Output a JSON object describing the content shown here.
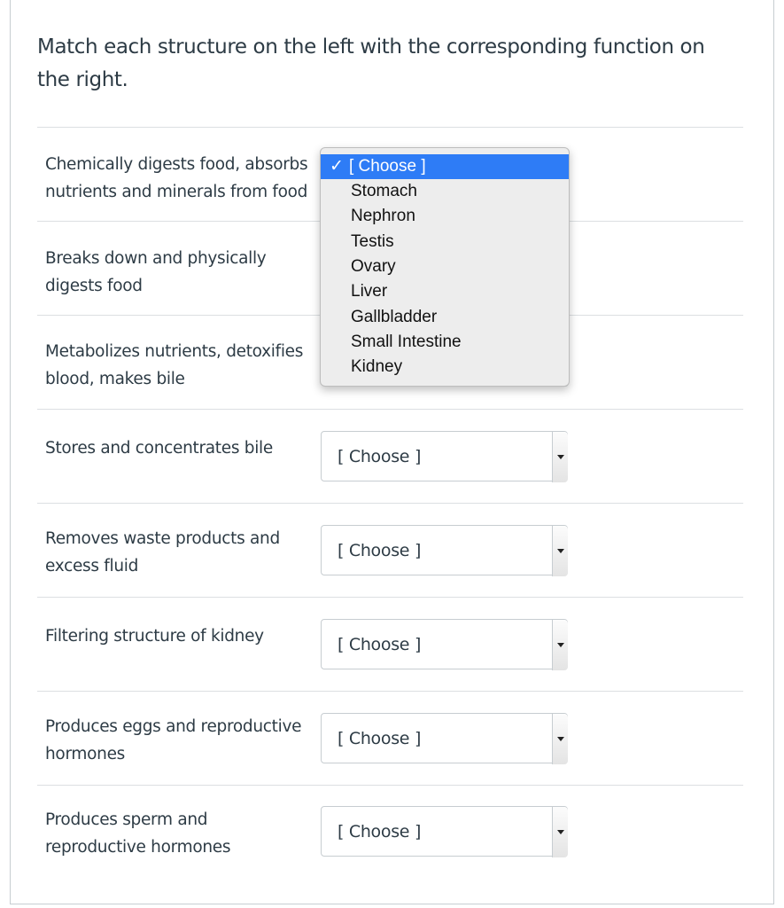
{
  "prompt": "Match each structure on the left with the corresponding function on the right.",
  "rows": [
    {
      "label_line1": "Chemically digests food, absorbs",
      "label_line2": "nutrients and minerals from food",
      "value": "[ Choose ]"
    },
    {
      "label_line1": "Breaks down and physically",
      "label_line2": "digests food",
      "value": "[ Choose ]"
    },
    {
      "label_line1": "Metabolizes nutrients, detoxifies",
      "label_line2": "blood, makes bile",
      "value": "[ Choose ]"
    },
    {
      "label_line1": "Stores and concentrates bile",
      "label_line2": "",
      "value": "[ Choose ]"
    },
    {
      "label_line1": "Removes waste products and",
      "label_line2": "excess fluid",
      "value": "[ Choose ]"
    },
    {
      "label_line1": "Filtering structure of kidney",
      "label_line2": "",
      "value": "[ Choose ]"
    },
    {
      "label_line1": "Produces eggs and reproductive",
      "label_line2": "hormones",
      "value": "[ Choose ]"
    },
    {
      "label_line1": "Produces sperm and",
      "label_line2": "reproductive hormones",
      "value": "[ Choose ]"
    }
  ],
  "dropdown": {
    "check": "✓",
    "options": [
      "[ Choose ]",
      "Stomach",
      "Nephron",
      "Testis",
      "Ovary",
      "Liver",
      "Gallbladder",
      "Small Intestine",
      "Kidney"
    ]
  }
}
